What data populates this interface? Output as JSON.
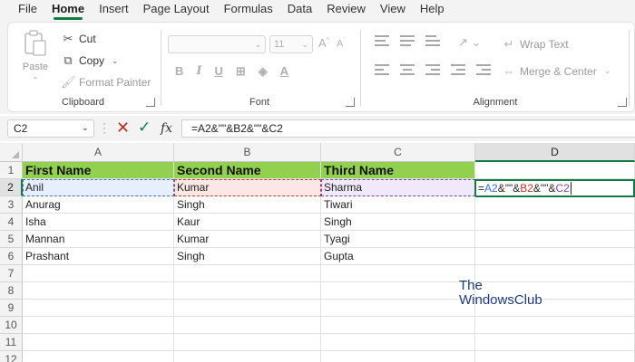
{
  "menu": [
    "File",
    "Home",
    "Insert",
    "Page Layout",
    "Formulas",
    "Data",
    "Review",
    "View",
    "Help"
  ],
  "active_menu": "Home",
  "ribbon": {
    "clipboard": {
      "paste": "Paste",
      "cut": "Cut",
      "copy": "Copy",
      "format_painter": "Format Painter",
      "label": "Clipboard"
    },
    "font": {
      "font_name": "",
      "font_size": "11",
      "label": "Font"
    },
    "alignment": {
      "wrap_text": "Wrap Text",
      "merge_center": "Merge & Center",
      "label": "Alignment"
    }
  },
  "formula_bar": {
    "name_box": "C2",
    "formula": "=A2&\"\"&B2&\"\"&C2"
  },
  "sheet": {
    "columns": [
      "A",
      "B",
      "C",
      "D"
    ],
    "selected_column": "D",
    "rows": [
      "1",
      "2",
      "3",
      "4",
      "5",
      "6",
      "7",
      "8",
      "9",
      "10",
      "11",
      "12"
    ],
    "selected_row": "2",
    "headers": [
      "First Name",
      "Second Name",
      "Third Name"
    ],
    "data": [
      [
        "Anil",
        "Kumar",
        "Sharma"
      ],
      [
        "Anurag",
        "Singh",
        "Tiwari"
      ],
      [
        "Isha",
        "Kaur",
        "Singh"
      ],
      [
        "Mannan",
        "Kumar",
        "Tyagi"
      ],
      [
        "Prashant",
        "Singh",
        "Gupta"
      ]
    ],
    "editing_cell": {
      "ref": "D2",
      "parts": [
        "=",
        "A2",
        "&\"\"&",
        "B2",
        "&\"\"&",
        "C2"
      ]
    },
    "header_fill": "#92d050"
  },
  "watermark": {
    "line1": "The",
    "line2": "WindowsClub"
  },
  "colors": {
    "accent": "#107c41",
    "ref_a": "#3a6fd8",
    "ref_b": "#c0392b",
    "ref_c": "#7b3fb0"
  }
}
